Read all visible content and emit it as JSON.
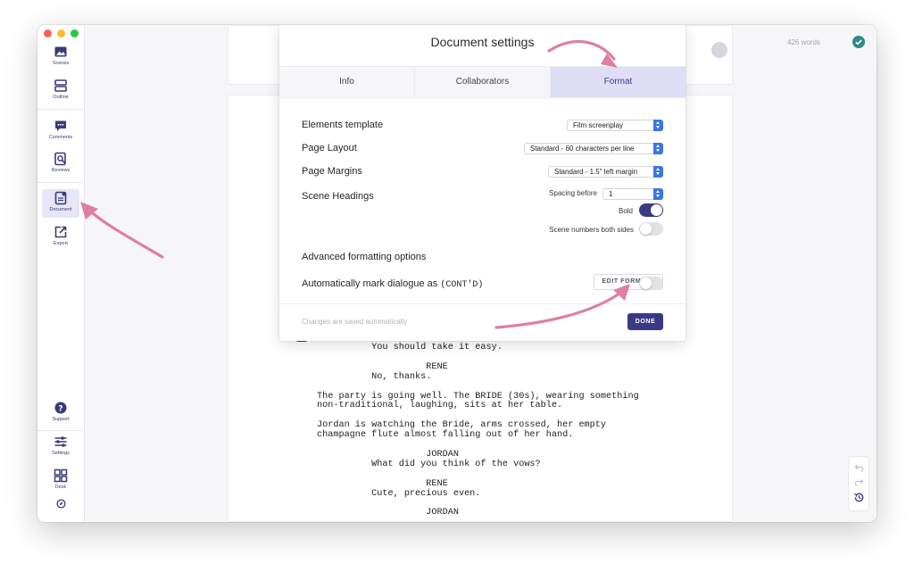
{
  "sidebar": {
    "items": [
      {
        "label": "Scenes",
        "icon": "image-icon"
      },
      {
        "label": "Outline",
        "icon": "outline-icon"
      },
      {
        "label": "Comments",
        "icon": "comment-icon"
      },
      {
        "label": "Reviews",
        "icon": "review-icon"
      },
      {
        "label": "Document",
        "icon": "document-icon"
      },
      {
        "label": "Export",
        "icon": "export-icon"
      },
      {
        "label": "Support",
        "icon": "help-icon"
      },
      {
        "label": "Settings",
        "icon": "sliders-icon"
      },
      {
        "label": "Desk",
        "icon": "grid-icon"
      }
    ]
  },
  "header": {
    "word_count": "426 words"
  },
  "modal": {
    "title": "Document settings",
    "tabs": [
      "Info",
      "Collaborators",
      "Format"
    ],
    "active_tab": "Format",
    "elements_template": {
      "label": "Elements template",
      "value": "Film screenplay"
    },
    "page_layout": {
      "label": "Page Layout",
      "value": "Standard - 60 characters per line"
    },
    "page_margins": {
      "label": "Page Margins",
      "value": "Standard - 1.5\" left margin"
    },
    "scene_headings": {
      "label": "Scene Headings",
      "spacing_label": "Spacing before",
      "spacing_value": "1",
      "bold_label": "Bold",
      "bold_on": true,
      "numbers_label": "Scene numbers both sides",
      "numbers_on": false
    },
    "advanced": {
      "label": "Advanced formatting options",
      "button": "EDIT FORMATS"
    },
    "contd": {
      "label": "Automatically mark dialogue as",
      "code": "(CONT'D)",
      "on": false
    },
    "saved_note": "Changes are saved automatically",
    "done": "DONE"
  },
  "script": [
    "          You should take it easy.",
    "",
    "                    RENE",
    "          No, thanks.",
    "",
    "The party is going well. The BRIDE (30s), wearing something",
    "non-traditional, laughing, sits at her table.",
    "",
    "Jordan is watching the Bride, arms crossed, her empty",
    "champagne flute almost falling out of her hand.",
    "",
    "                    JORDAN",
    "          What did you think of the vows?",
    "",
    "                    RENE",
    "          Cute, precious even.",
    "",
    "                    JORDAN"
  ],
  "colors": {
    "accent": "#3b3b84",
    "tab_active": "#dedef6",
    "arrow": "#de7fa4",
    "select": "#3a76e6"
  }
}
